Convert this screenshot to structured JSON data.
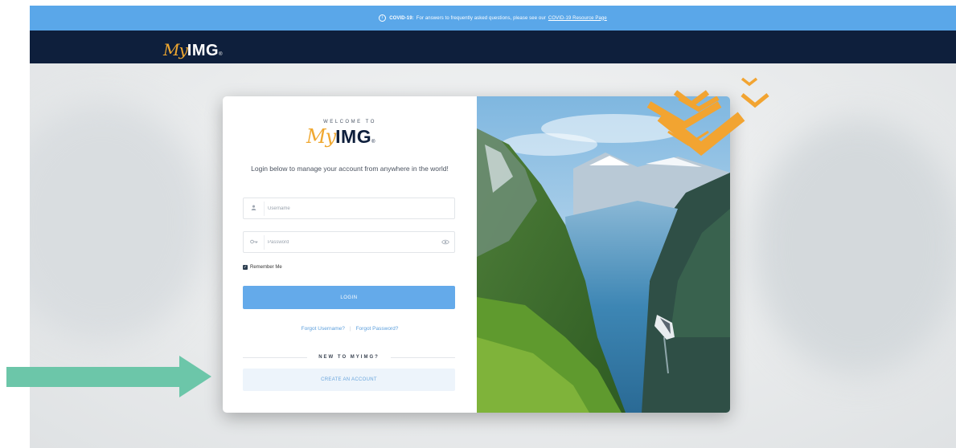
{
  "banner": {
    "icon": "info-circle-icon",
    "prefix": "COVID-19:",
    "text": "For answers to frequently asked questions, please see our",
    "link": "COVID-19 Resource Page"
  },
  "navbar": {
    "logo_my": "My",
    "logo_img": "IMG",
    "logo_reg": "®"
  },
  "card": {
    "welcome": "WELCOME TO",
    "logo_my": "My",
    "logo_img": "IMG",
    "logo_reg": "®",
    "tagline": "Login below to manage your account from anywhere in the world!",
    "username": {
      "icon": "user-icon",
      "placeholder": "Username",
      "value": ""
    },
    "password": {
      "icon": "key-icon",
      "placeholder": "Password",
      "value": "",
      "toggle_icon": "eye-icon"
    },
    "remember_label": "Remember Me",
    "remember_checked": true,
    "login_label": "LOGIN",
    "forgot_username": "Forgot Username?",
    "forgot_separator": "|",
    "forgot_password": "Forgot Password?",
    "new_to": "NEW TO MYIMG?",
    "create_label": "CREATE AN ACCOUNT"
  },
  "colors": {
    "banner": "#5aa7e9",
    "navbar": "#0e1f3c",
    "login_button": "#64aaea",
    "create_button": "#edf4fb",
    "brand_orange": "#f0a830",
    "annotation_arrow": "#6cc6a9"
  }
}
